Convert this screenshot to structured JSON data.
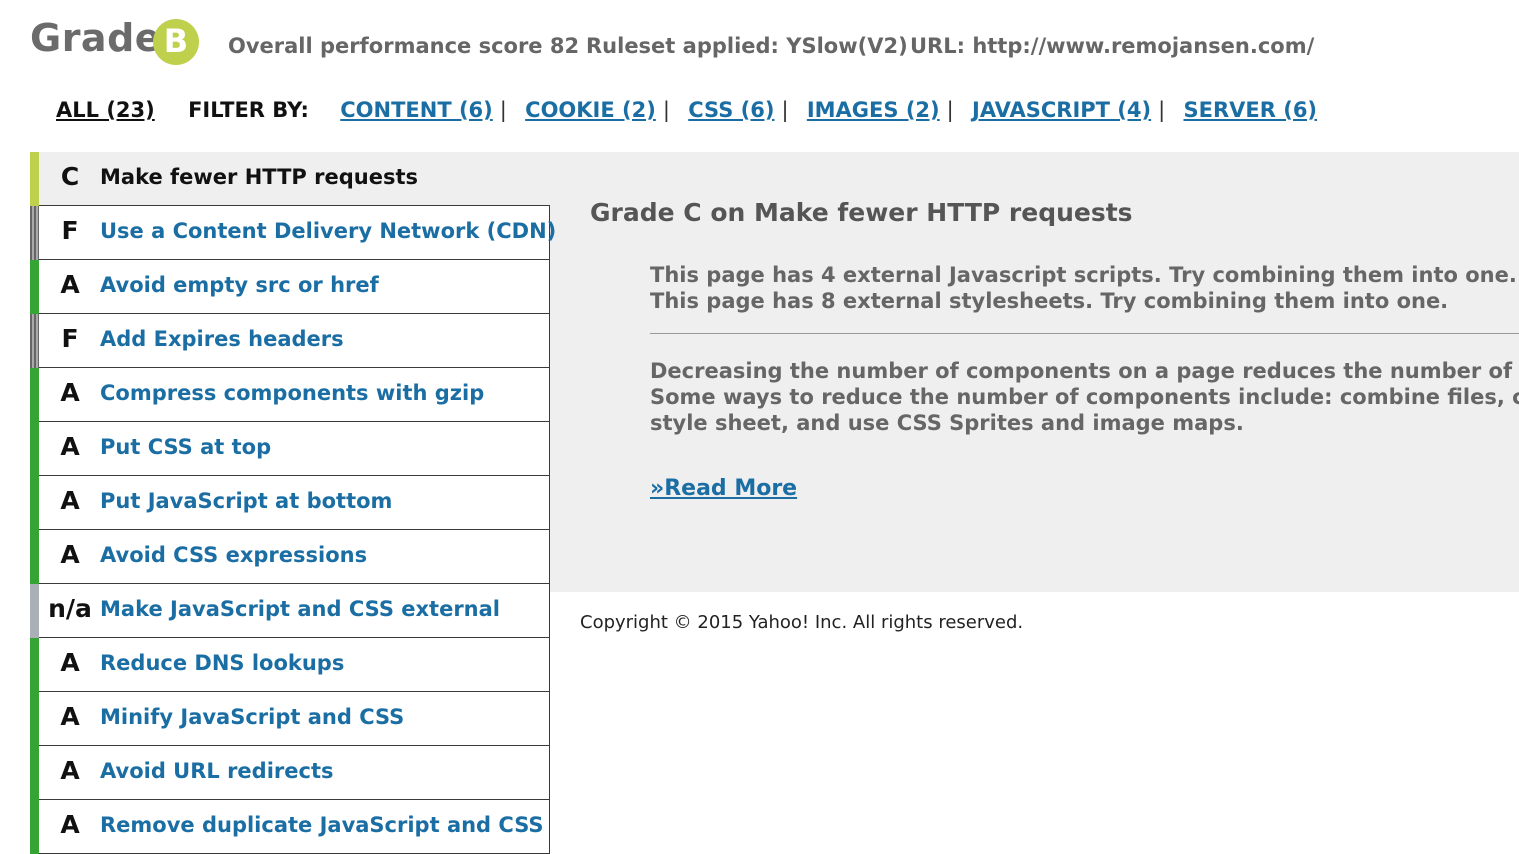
{
  "header": {
    "grade_word": "Grade",
    "grade_letter": "B",
    "score_text": "Overall performance score 82",
    "ruleset_text": "Ruleset applied: YSlow(V2)",
    "url_text": "URL: http://www.remojansen.com/"
  },
  "filter": {
    "all_label": "ALL (23)",
    "filter_by_label": "FILTER BY:",
    "categories": [
      {
        "label": "CONTENT (6)"
      },
      {
        "label": "COOKIE (2)"
      },
      {
        "label": "CSS (6)"
      },
      {
        "label": "IMAGES (2)"
      },
      {
        "label": "JAVASCRIPT (4)"
      },
      {
        "label": "SERVER (6)"
      }
    ]
  },
  "rules": [
    {
      "grade": "C",
      "title": "Make fewer HTTP requests",
      "selected": true
    },
    {
      "grade": "F",
      "title": "Use a Content Delivery Network (CDN)"
    },
    {
      "grade": "A",
      "title": "Avoid empty src or href"
    },
    {
      "grade": "F",
      "title": "Add Expires headers"
    },
    {
      "grade": "A",
      "title": "Compress components with gzip"
    },
    {
      "grade": "A",
      "title": "Put CSS at top"
    },
    {
      "grade": "A",
      "title": "Put JavaScript at bottom"
    },
    {
      "grade": "A",
      "title": "Avoid CSS expressions"
    },
    {
      "grade": "n/a",
      "title": "Make JavaScript and CSS external"
    },
    {
      "grade": "A",
      "title": "Reduce DNS lookups"
    },
    {
      "grade": "A",
      "title": "Minify JavaScript and CSS"
    },
    {
      "grade": "A",
      "title": "Avoid URL redirects"
    },
    {
      "grade": "A",
      "title": "Remove duplicate JavaScript and CSS"
    }
  ],
  "detail": {
    "title": "Grade C on Make fewer HTTP requests",
    "findings": [
      "This page has 4 external Javascript scripts. Try combining them into one.",
      "This page has 8 external stylesheets. Try combining them into one."
    ],
    "description": [
      "Decreasing the number of components on a page reduces the number of HT",
      "Some ways to reduce the number of components include: combine files, com",
      "style sheet, and use CSS Sprites and image maps."
    ],
    "read_more": "»Read More"
  },
  "footer": {
    "copyright": "Copyright © 2015 Yahoo! Inc. All rights reserved."
  },
  "colors": {
    "link": "#1b6ea3",
    "grade_b_badge": "#bed04c",
    "grade_a": "#34a534",
    "grade_c": "#bed04c",
    "grade_f": "#777777",
    "grade_na": "#aab0b6",
    "panel_bg": "#efefef"
  }
}
